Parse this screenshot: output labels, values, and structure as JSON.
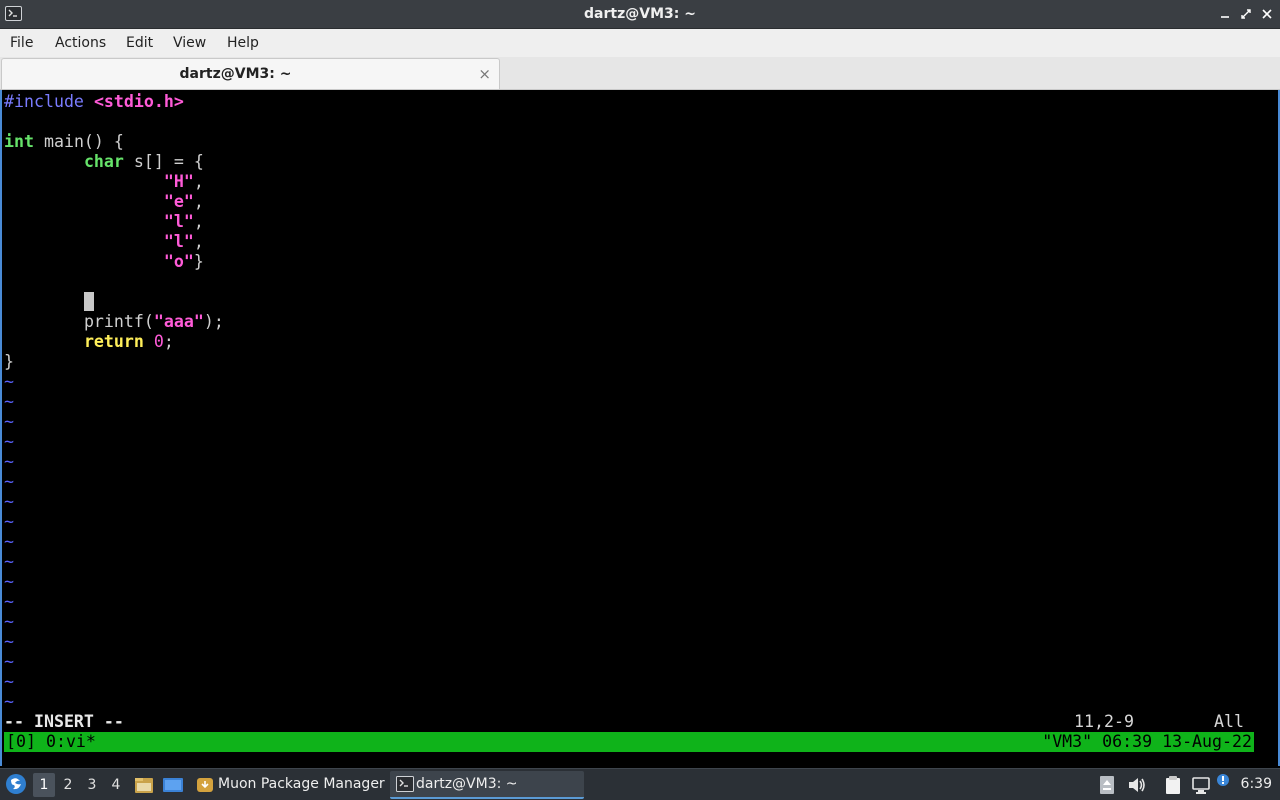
{
  "window": {
    "title": "dartz@VM3: ~",
    "minimize": "▁",
    "restore": "⤢",
    "close": "✕"
  },
  "menu": [
    "File",
    "Actions",
    "Edit",
    "View",
    "Help"
  ],
  "tab": {
    "label": "dartz@VM3: ~",
    "close": "×"
  },
  "code": {
    "include_kw": "#include",
    "include_hdr": "<stdio.h>",
    "int_kw": "int",
    "main_sig": " main() {",
    "char_kw": "char",
    "arr_decl": " s[] = {",
    "str_H": "\"H\"",
    "str_e": "\"e\"",
    "str_l1": "\"l\"",
    "str_l2": "\"l\"",
    "str_o": "\"o\"",
    "comma": ",",
    "close_brace_inner": "}",
    "printf_open": "printf(",
    "printf_str": "\"aaa\"",
    "printf_close": ");",
    "return_kw": "return",
    "zero": "0",
    "semicolon": ";",
    "close_brace": "}",
    "tilde": "~"
  },
  "vim": {
    "mode": "-- INSERT --",
    "position": "11,2-9",
    "scroll": "All"
  },
  "tmux": {
    "left": "[0] 0:vi*",
    "right": "\"VM3\" 06:39 13-Aug-22"
  },
  "taskbar": {
    "desktops": [
      "1",
      "2",
      "3",
      "4"
    ],
    "active_desktop": "1",
    "tasks": [
      {
        "label": "Muon Package Manager",
        "icon": "package-icon"
      },
      {
        "label": "dartz@VM3: ~",
        "icon": "terminal-icon"
      }
    ],
    "clock": "6:39"
  }
}
